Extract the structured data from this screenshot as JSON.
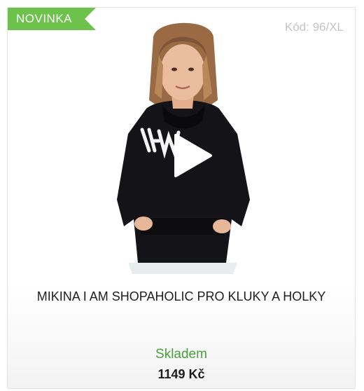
{
  "product": {
    "badge": "NOVINKA",
    "code": "Kód: 96/XL",
    "media_icon": "play-icon",
    "name": "MIKINA I AM SHOPAHOLIC PRO KLUKY A HOLKY",
    "availability": "Skladem",
    "price": "1149 Kč"
  },
  "colors": {
    "badge": "#6cc24a",
    "availability": "#4aa13c",
    "code": "#c4c4c4",
    "text": "#1e1e1e"
  }
}
